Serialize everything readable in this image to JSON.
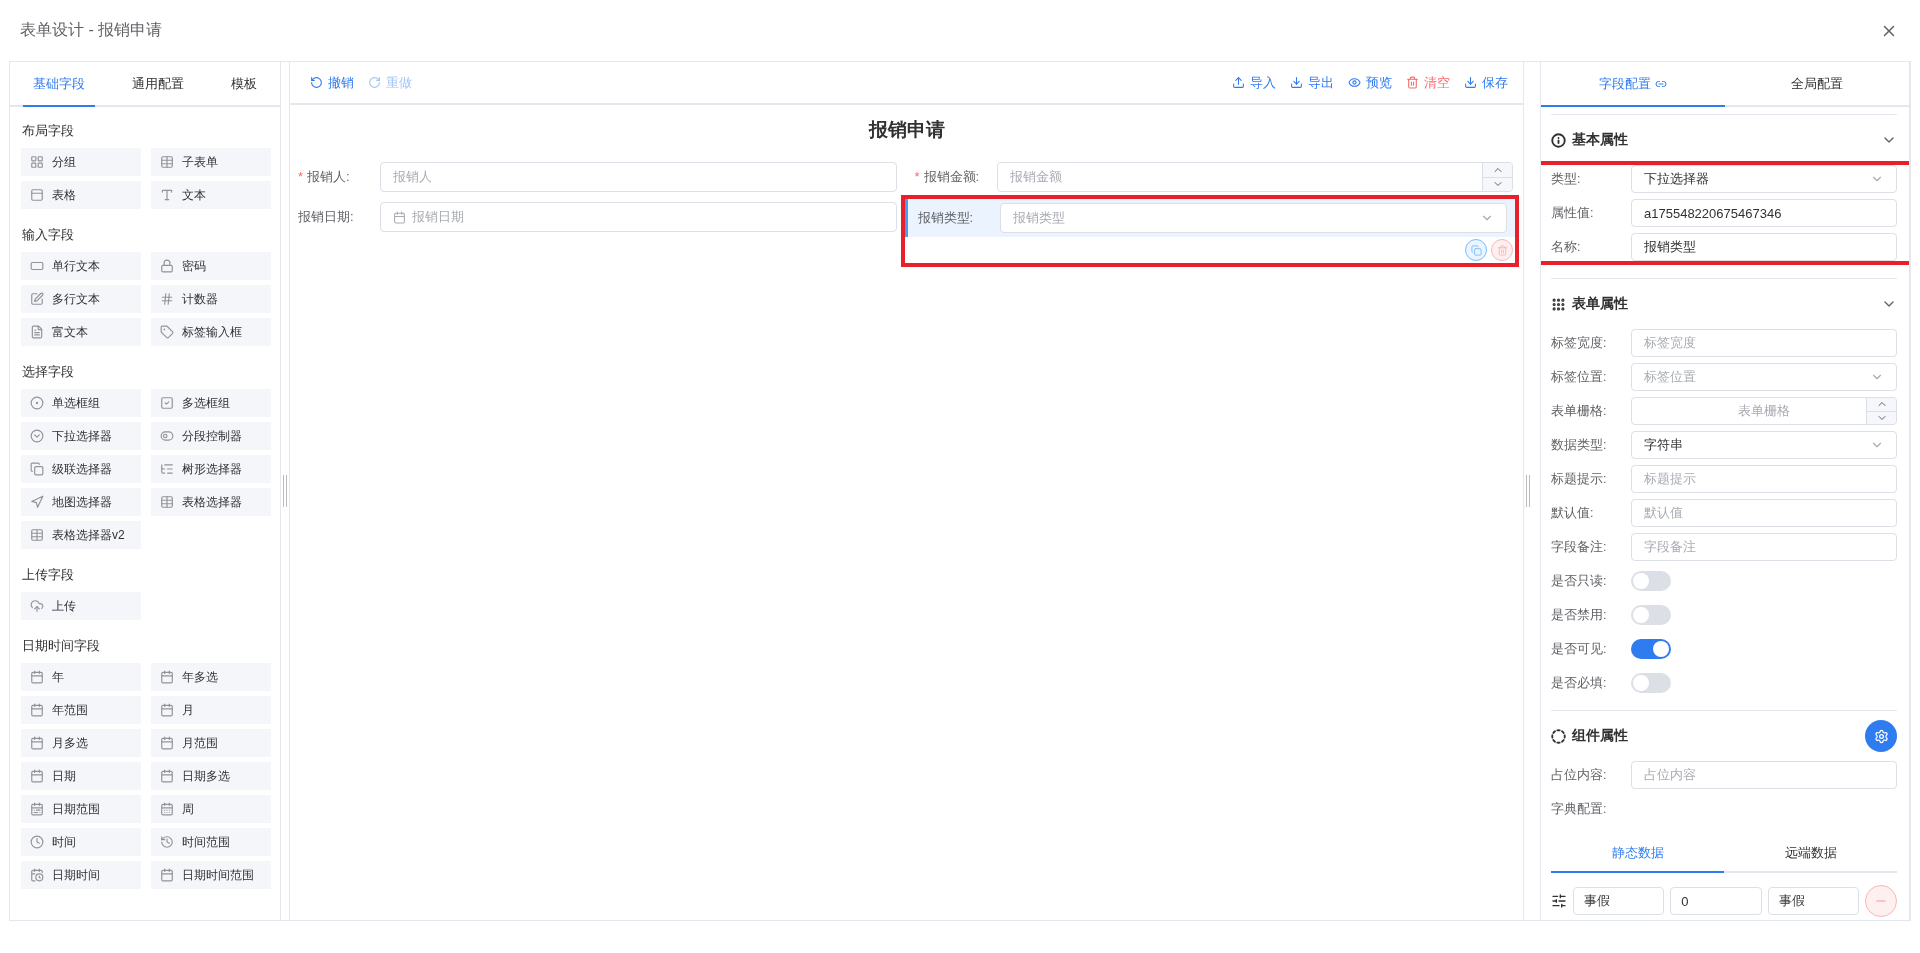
{
  "window": {
    "title": "表单设计 - 报销申请"
  },
  "palette": {
    "tabs": [
      {
        "label": "基础字段",
        "selected": true
      },
      {
        "label": "通用配置",
        "selected": false
      },
      {
        "label": "模板",
        "selected": false
      }
    ],
    "groups": [
      {
        "title": "布局字段",
        "items": [
          {
            "label": "分组",
            "kind": "grid"
          },
          {
            "label": "子表单",
            "kind": "table"
          },
          {
            "label": "表格",
            "kind": "sheet"
          },
          {
            "label": "文本",
            "kind": "text"
          }
        ]
      },
      {
        "title": "输入字段",
        "items": [
          {
            "label": "单行文本",
            "kind": "input"
          },
          {
            "label": "密码",
            "kind": "lock"
          },
          {
            "label": "多行文本",
            "kind": "textarea"
          },
          {
            "label": "计数器",
            "kind": "number"
          },
          {
            "label": "富文本",
            "kind": "richtext"
          },
          {
            "label": "标签输入框",
            "kind": "tag"
          }
        ]
      },
      {
        "title": "选择字段",
        "items": [
          {
            "label": "单选框组",
            "kind": "radio"
          },
          {
            "label": "多选框组",
            "kind": "checkbox"
          },
          {
            "label": "下拉选择器",
            "kind": "select"
          },
          {
            "label": "分段控制器",
            "kind": "segment"
          },
          {
            "label": "级联选择器",
            "kind": "cascader"
          },
          {
            "label": "树形选择器",
            "kind": "tree"
          },
          {
            "label": "地图选择器",
            "kind": "map"
          },
          {
            "label": "表格选择器",
            "kind": "table"
          },
          {
            "label": "表格选择器v2",
            "kind": "table"
          }
        ]
      },
      {
        "title": "上传字段",
        "items": [
          {
            "label": "上传",
            "kind": "upload"
          }
        ]
      },
      {
        "title": "日期时间字段",
        "items": [
          {
            "label": "年",
            "kind": "calendar"
          },
          {
            "label": "年多选",
            "kind": "calendar"
          },
          {
            "label": "年范围",
            "kind": "calendar"
          },
          {
            "label": "月",
            "kind": "calendar"
          },
          {
            "label": "月多选",
            "kind": "calendar"
          },
          {
            "label": "月范围",
            "kind": "calendar"
          },
          {
            "label": "日期",
            "kind": "calendar"
          },
          {
            "label": "日期多选",
            "kind": "calendar"
          },
          {
            "label": "日期范围",
            "kind": "range"
          },
          {
            "label": "周",
            "kind": "week"
          },
          {
            "label": "时间",
            "kind": "clock"
          },
          {
            "label": "时间范围",
            "kind": "history"
          },
          {
            "label": "日期时间",
            "kind": "datetime"
          },
          {
            "label": "日期时间范围",
            "kind": "calendar"
          }
        ]
      }
    ]
  },
  "toolbar": {
    "left": [
      {
        "label": "撤销",
        "kind": "undo",
        "disabled": false
      },
      {
        "label": "重做",
        "kind": "redo",
        "disabled": true
      }
    ],
    "right": [
      {
        "label": "导入",
        "kind": "upload",
        "danger": false
      },
      {
        "label": "导出",
        "kind": "download",
        "danger": false
      },
      {
        "label": "预览",
        "kind": "eye",
        "danger": false
      },
      {
        "label": "清空",
        "kind": "trash",
        "danger": true
      },
      {
        "label": "保存",
        "kind": "download",
        "danger": false
      }
    ]
  },
  "form": {
    "title": "报销申请",
    "fields": [
      {
        "label": "报销人:",
        "placeholder": "报销人",
        "kind": "input",
        "required_mark": "*",
        "selected": false
      },
      {
        "label": "报销金额:",
        "placeholder": "报销金额",
        "kind": "number",
        "required_mark": "*",
        "selected": false
      },
      {
        "label": "报销日期:",
        "placeholder": "报销日期",
        "kind": "date",
        "selected": false
      },
      {
        "label": "报销类型:",
        "placeholder": "报销类型",
        "kind": "select",
        "selected": true
      }
    ]
  },
  "config": {
    "tabs": [
      {
        "label": "字段配置",
        "selected": true
      },
      {
        "label": "全局配置",
        "selected": false
      }
    ],
    "sections": [
      {
        "title": "基本属性",
        "kind": "info",
        "expanded": true,
        "highlighted": true,
        "rows": [
          {
            "label": "类型:",
            "kind": "select",
            "value": "下拉选择器"
          },
          {
            "label": "属性值:",
            "kind": "input",
            "value": "a175548220675467346"
          },
          {
            "label": "名称:",
            "kind": "input",
            "value": "报销类型"
          }
        ]
      },
      {
        "title": "表单属性",
        "kind": "grid",
        "expanded": true,
        "highlighted": false,
        "rows": [
          {
            "label": "标签宽度:",
            "kind": "input",
            "placeholder": "标签宽度"
          },
          {
            "label": "标签位置:",
            "kind": "select",
            "placeholder": "标签位置"
          },
          {
            "label": "表单栅格:",
            "kind": "number",
            "placeholder": "表单栅格"
          },
          {
            "label": "数据类型:",
            "kind": "select",
            "value": "字符串"
          },
          {
            "label": "标题提示:",
            "kind": "input",
            "placeholder": "标题提示"
          },
          {
            "label": "默认值:",
            "kind": "input",
            "placeholder": "默认值"
          },
          {
            "label": "字段备注:",
            "kind": "input",
            "placeholder": "字段备注"
          },
          {
            "label": "是否只读:",
            "kind": "switch",
            "on": false
          },
          {
            "label": "是否禁用:",
            "kind": "switch",
            "on": false
          },
          {
            "label": "是否可见:",
            "kind": "switch",
            "on": true
          },
          {
            "label": "是否必填:",
            "kind": "switch",
            "on": false
          }
        ]
      },
      {
        "title": "组件属性",
        "kind": "component",
        "highlighted": false,
        "rows": [
          {
            "label": "占位内容:",
            "kind": "input",
            "placeholder": "占位内容"
          },
          {
            "label": "字典配置:",
            "kind": "text"
          }
        ]
      }
    ],
    "dict_tabs": [
      {
        "label": "静态数据",
        "selected": true
      },
      {
        "label": "远端数据",
        "selected": false
      }
    ],
    "options": [
      {
        "cells": [
          "事假",
          "0",
          "事假"
        ]
      }
    ]
  }
}
